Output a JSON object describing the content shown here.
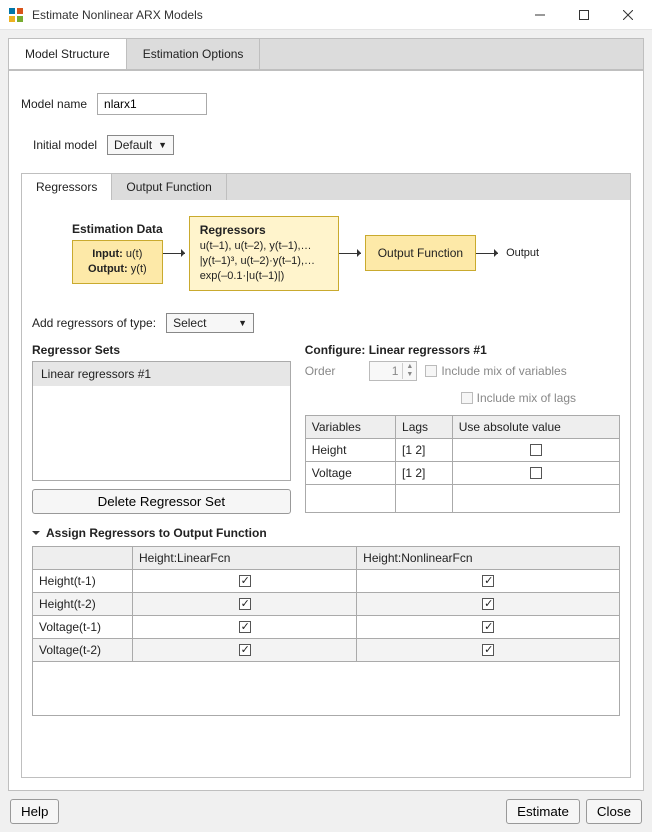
{
  "window": {
    "title": "Estimate Nonlinear ARX Models"
  },
  "tabs": {
    "model_structure": "Model Structure",
    "estimation_options": "Estimation Options"
  },
  "fields": {
    "model_name_label": "Model name",
    "model_name_value": "nlarx1",
    "initial_model_label": "Initial model",
    "initial_model_value": "Default"
  },
  "inner_tabs": {
    "regressors": "Regressors",
    "output_function": "Output Function"
  },
  "diagram": {
    "est_data_cap": "Estimation Data",
    "est_input_label": "Input:",
    "est_input_val": " u(t)",
    "est_output_label": "Output:",
    "est_output_val": " y(t)",
    "reg_title": "Regressors",
    "reg_l1": "u(t–1), u(t–2), y(t–1),…",
    "reg_l2": "|y(t–1)³, u(t–2)·y(t–1),…",
    "reg_l3": "exp(–0.1·|u(t–1)|)",
    "outfcn_box": "Output Function",
    "output_label": "Output"
  },
  "add_reg": {
    "label": "Add regressors of type:",
    "select_value": "Select"
  },
  "reg_sets": {
    "title": "Regressor Sets",
    "items": [
      "Linear regressors #1"
    ],
    "delete_btn": "Delete Regressor Set"
  },
  "configure": {
    "title": "Configure: Linear regressors #1",
    "order_label": "Order",
    "order_value": "1",
    "mix_vars": "Include mix of variables",
    "mix_lags": "Include mix of lags",
    "cols": {
      "var": "Variables",
      "lags": "Lags",
      "abs": "Use absolute value"
    },
    "rows": [
      {
        "var": "Height",
        "lags": "[1 2]",
        "abs": false
      },
      {
        "var": "Voltage",
        "lags": "[1 2]",
        "abs": false
      }
    ]
  },
  "assign": {
    "title": "Assign Regressors to Output Function",
    "cols": {
      "blank": "",
      "lin": "Height:LinearFcn",
      "nl": "Height:NonlinearFcn"
    },
    "rows": [
      {
        "name": "Height(t-1)",
        "lin": true,
        "nl": true
      },
      {
        "name": "Height(t-2)",
        "lin": true,
        "nl": true
      },
      {
        "name": "Voltage(t-1)",
        "lin": true,
        "nl": true
      },
      {
        "name": "Voltage(t-2)",
        "lin": true,
        "nl": true
      }
    ]
  },
  "footer": {
    "help": "Help",
    "estimate": "Estimate",
    "close": "Close"
  }
}
